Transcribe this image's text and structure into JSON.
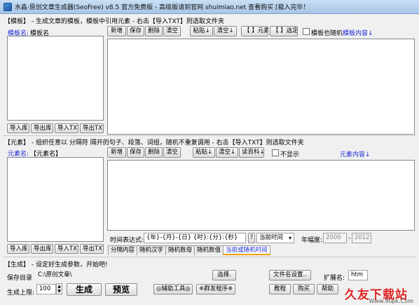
{
  "window": {
    "title": "水淼·原创文章生成器(SeoFree) v8.5 官方免费版 - 高级版请到官网 shuimiao.net 查看购买 [载入完毕！"
  },
  "template_section": {
    "header": "【模板】 - 生成文章的模板，模板中引用元素 - 右击【导入TXT】则选取文件夹",
    "name_label": "模板名:",
    "name_value": "模板名",
    "buttons": [
      "新增",
      "保存",
      "删除",
      "清空"
    ],
    "paste_btn": "粘贴↓",
    "clear_btn": "清空↓",
    "element_btn": "【 】元素",
    "selected_btn": "【 】选定",
    "random_checkbox_label": "模板也随机",
    "content_label": "模板内容↓",
    "bottom_buttons": [
      "导入库",
      "导出库",
      "导入TXT",
      "导出TXT"
    ]
  },
  "element_section": {
    "header": "【元素】 - 组织任意以 分隔符 隔开的句子、段落、词组，随机不重复调用 - 右击【导入TXT】则选取文件夹",
    "name_label": "元素名:",
    "name_value": "【元素名】",
    "buttons": [
      "新增",
      "保存",
      "删除",
      "清空"
    ],
    "paste_btn": "粘贴↓",
    "clear_btn": "清空↓",
    "baike_btn": "读百科↓",
    "hide_checkbox_label": "不显示",
    "content_label": "元素内容↓",
    "time_expr_label": "时间表达式:",
    "time_expr_value": "{年}-{月}-{日} {时}:{分}:{秒}",
    "question_btn": "?",
    "time_mode": "当前时间",
    "year_range_label": "年幅度:",
    "year_from": "2000",
    "year_sep": "-",
    "year_to": "2012",
    "tabs": [
      "分隔内容",
      "随机汉字",
      "随机数母",
      "随机数值",
      "当前或随机时间"
    ],
    "active_tab": 4,
    "bottom_buttons": [
      "导入库",
      "导出库",
      "导入TXT",
      "导出TXT"
    ]
  },
  "generate_section": {
    "header": "【生成】 - 设定好生成参数，开始吧!",
    "save_dir_label": "保存目录",
    "save_dir_value": "C:\\原创文章\\",
    "select_btn": "选择.",
    "filename_btn": "文件名设置..",
    "ext_label": "扩展名:",
    "ext_value": "htm",
    "limit_label": "生成上限:",
    "limit_value": "100",
    "generate_btn": "生成",
    "preview_btn": "预览",
    "aux_tools_btn": "◎辅助工具◎",
    "mass_send_btn": "※群发程序※",
    "tutorial_btn": "教程",
    "buy_btn": "购买",
    "help_btn": "帮助"
  },
  "watermark": {
    "text": "久友下载站",
    "url": "Www.9upk.Com"
  }
}
